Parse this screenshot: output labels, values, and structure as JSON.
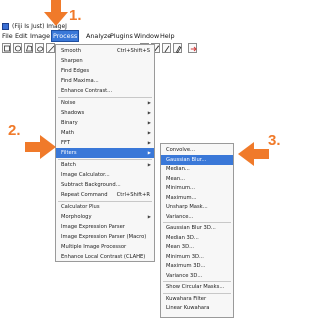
{
  "window": {
    "title": "(Fiji Is Just) ImageJ"
  },
  "menubar": [
    "File",
    "Edit",
    "Image",
    "Process",
    "Analyze",
    "Plugins",
    "Window",
    "Help"
  ],
  "callouts": [
    "1.",
    "2.",
    "3."
  ],
  "process_menu": [
    {
      "label": "Smooth",
      "shortcut": "Ctrl+Shift+S"
    },
    {
      "label": "Sharpen"
    },
    {
      "label": "Find Edges"
    },
    {
      "label": "Find Maxima..."
    },
    {
      "label": "Enhance Contrast..."
    },
    {
      "label": "Noise",
      "submenu": true
    },
    {
      "label": "Shadows",
      "submenu": true
    },
    {
      "label": "Binary",
      "submenu": true
    },
    {
      "label": "Math",
      "submenu": true
    },
    {
      "label": "FFT",
      "submenu": true
    },
    {
      "label": "Filters",
      "submenu": true,
      "highlighted": true
    },
    {
      "label": "Batch",
      "submenu": true
    },
    {
      "label": "Image Calculator..."
    },
    {
      "label": "Subtract Background..."
    },
    {
      "label": "Repeat Command",
      "shortcut": "Ctrl+Shift+R"
    },
    {
      "label": "Calculator Plus"
    },
    {
      "label": "Morphology",
      "submenu": true
    },
    {
      "label": "Image Expression Parser"
    },
    {
      "label": "Image Expression Parser (Macro)"
    },
    {
      "label": "Multiple Image Processor"
    },
    {
      "label": "Enhance Local Contrast (CLAHE)"
    }
  ],
  "filters_menu": [
    {
      "label": "Convolve..."
    },
    {
      "label": "Gaussian Blur...",
      "highlighted": true
    },
    {
      "label": "Median..."
    },
    {
      "label": "Mean..."
    },
    {
      "label": "Minimum..."
    },
    {
      "label": "Maximum..."
    },
    {
      "label": "Unsharp Mask..."
    },
    {
      "label": "Variance..."
    },
    {
      "label": "Gaussian Blur 3D..."
    },
    {
      "label": "Median 3D..."
    },
    {
      "label": "Mean 3D..."
    },
    {
      "label": "Minimum 3D..."
    },
    {
      "label": "Maximum 3D..."
    },
    {
      "label": "Variance 3D..."
    },
    {
      "label": "Show Circular Masks..."
    },
    {
      "label": "Kuwahara Filter"
    },
    {
      "label": "Linear Kuwahara"
    }
  ],
  "colors": {
    "accent": "#3a78d8",
    "callout": "#f07a2a"
  }
}
